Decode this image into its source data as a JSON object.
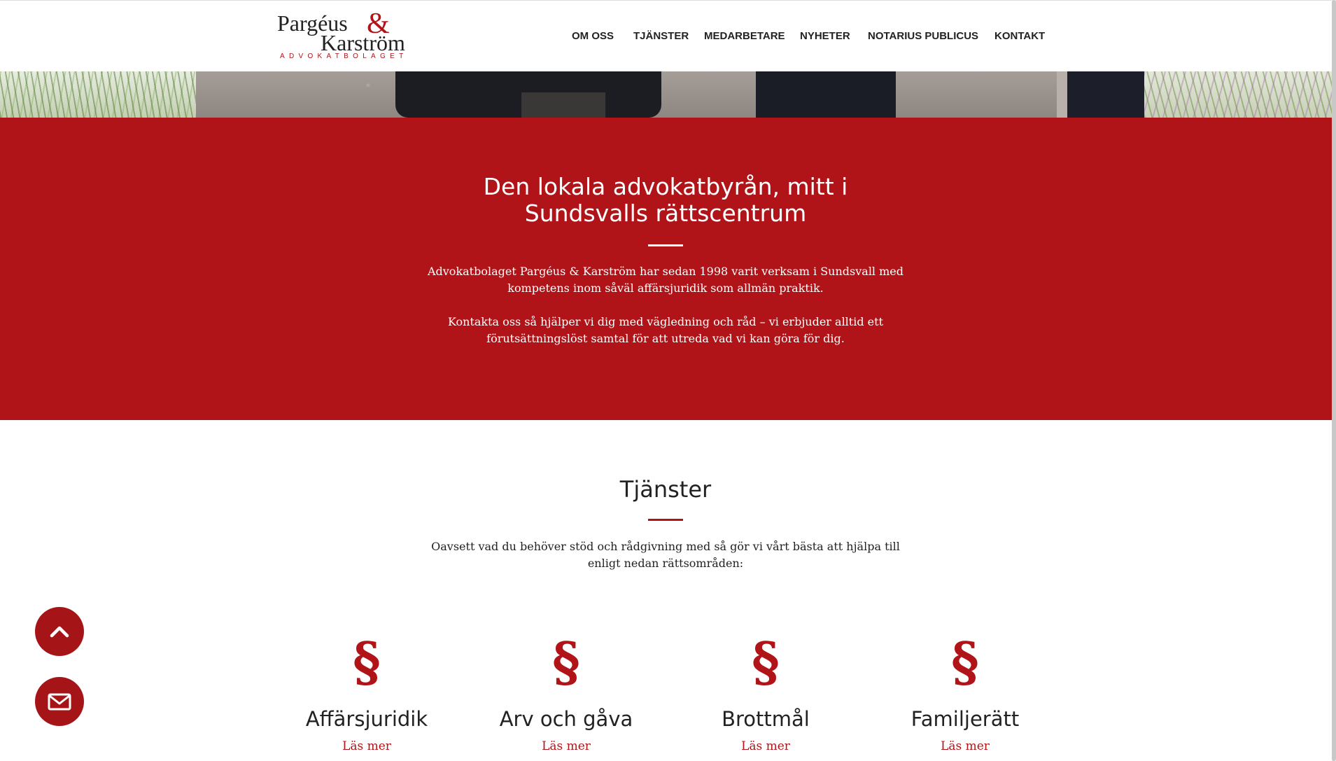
{
  "logo": {
    "line1": "Pargéus",
    "ampersand": "&",
    "line2": "Karström",
    "tagline": "ADVOKATBOLAGET"
  },
  "nav": {
    "items": [
      {
        "label": "OM OSS"
      },
      {
        "label": "TJÄNSTER"
      },
      {
        "label": "MEDARBETARE"
      },
      {
        "label": "NYHETER"
      },
      {
        "label": "NOTARIUS PUBLICUS"
      },
      {
        "label": "KONTAKT"
      }
    ]
  },
  "hero": {
    "title": "Den lokala advokatbyrån, mitt i Sundsvalls rättscentrum",
    "paragraph1": "Advokatbolaget Pargéus & Karström har sedan 1998 varit verksam i Sundsvall med kompetens inom såväl affärsjuridik som allmän praktik.",
    "paragraph2": "Kontakta oss så hjälper vi dig med vägledning och råd – vi erbjuder alltid ett förutsättningslöst samtal för att utreda vad vi kan göra för dig.",
    "background_color": "#b01418"
  },
  "services": {
    "title": "Tjänster",
    "intro": "Oavsett vad du behöver stöd och rådgivning med så gör vi vårt bästa att hjälpa till enligt nedan rättsområden:",
    "items": [
      {
        "icon": "§",
        "name": "Affärsjuridik",
        "link": "Läs mer"
      },
      {
        "icon": "§",
        "name": "Arv och gåva",
        "link": "Läs mer"
      },
      {
        "icon": "§",
        "name": "Brottmål",
        "link": "Läs mer"
      },
      {
        "icon": "§",
        "name": "Familjerätt",
        "link": "Läs mer"
      }
    ]
  },
  "floating_buttons": {
    "scroll_top_icon": "chevron-up-icon",
    "mail_icon": "envelope-icon"
  },
  "colors": {
    "accent": "#b01418",
    "text": "#222222"
  }
}
